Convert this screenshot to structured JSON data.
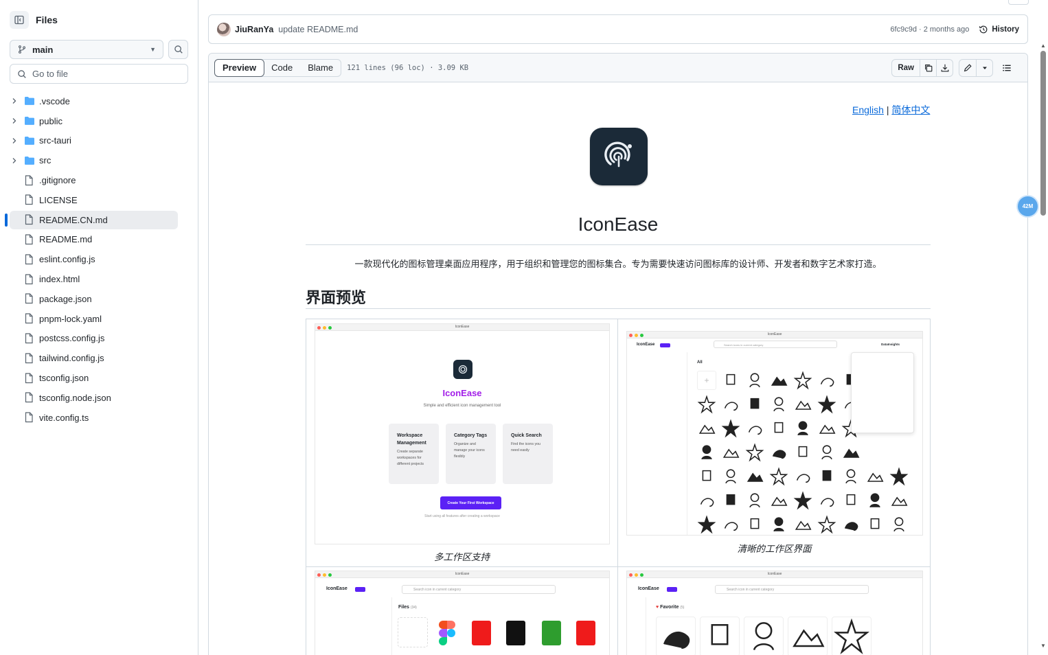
{
  "sidebar": {
    "title": "Files",
    "branch": "main",
    "goto_placeholder": "Go to file",
    "tree": [
      {
        "type": "folder",
        "label": ".vscode"
      },
      {
        "type": "folder",
        "label": "public"
      },
      {
        "type": "folder",
        "label": "src-tauri"
      },
      {
        "type": "folder",
        "label": "src"
      },
      {
        "type": "file",
        "label": ".gitignore"
      },
      {
        "type": "file",
        "label": "LICENSE"
      },
      {
        "type": "file",
        "label": "README.CN.md",
        "active": true
      },
      {
        "type": "file",
        "label": "README.md"
      },
      {
        "type": "file",
        "label": "eslint.config.js"
      },
      {
        "type": "file",
        "label": "index.html"
      },
      {
        "type": "file",
        "label": "package.json"
      },
      {
        "type": "file",
        "label": "pnpm-lock.yaml"
      },
      {
        "type": "file",
        "label": "postcss.config.js"
      },
      {
        "type": "file",
        "label": "tailwind.config.js"
      },
      {
        "type": "file",
        "label": "tsconfig.json"
      },
      {
        "type": "file",
        "label": "tsconfig.node.json"
      },
      {
        "type": "file",
        "label": "vite.config.ts"
      }
    ]
  },
  "commit": {
    "author": "JiuRanYa",
    "message": "update README.md",
    "meta": "6fc9c9d · 2 months ago",
    "history_label": "History"
  },
  "file_header": {
    "tabs": [
      "Preview",
      "Code",
      "Blame"
    ],
    "active_tab": "Preview",
    "stats": "121 lines (96 loc) · 3.09 KB",
    "raw_label": "Raw"
  },
  "readme": {
    "lang_en": "English",
    "lang_sep": "|",
    "lang_cn": "简体中文",
    "title": "IconEase",
    "description": "一款现代化的图标管理桌面应用程序，用于组织和管理您的图标集合。专为需要快速访问图标库的设计师、开发者和数字艺术家打造。",
    "section_heading": "界面预览",
    "captions": [
      "多工作区支持",
      "清晰的工作区界面"
    ],
    "shot1": {
      "window_title": "IconEase",
      "app_name": "IconEase",
      "tagline": "Simple and efficient icon management tool",
      "cards": [
        {
          "title": "Workspace Management",
          "body": "Create separate workspaces for different projects"
        },
        {
          "title": "Category Tags",
          "body": "Organize and manage your icons flexibly"
        },
        {
          "title": "Quick Search",
          "body": "Find the icons you need easily"
        }
      ],
      "cta": "Create Your First Workspace",
      "hint": "Start using all features after creating a workspace"
    },
    "shot2": {
      "window_title": "IconEase",
      "brand": "IconEase",
      "search_placeholder": "Search icons in current category",
      "section": "All",
      "workspace": "DataInsights"
    },
    "shot3": {
      "window_title": "IconEase",
      "brand": "IconEase",
      "search_placeholder": "Search icon in current category",
      "section": "Files",
      "count": "(34)"
    },
    "shot4": {
      "window_title": "IconEase",
      "brand": "IconEase",
      "search_placeholder": "Search icon in current category",
      "section": "Favorite",
      "count": "(5)"
    }
  },
  "floating_badge": "42M",
  "colors": {
    "accent": "#0969da",
    "cta_purple": "#5b21f5",
    "brand_purple": "#a21ee8"
  }
}
